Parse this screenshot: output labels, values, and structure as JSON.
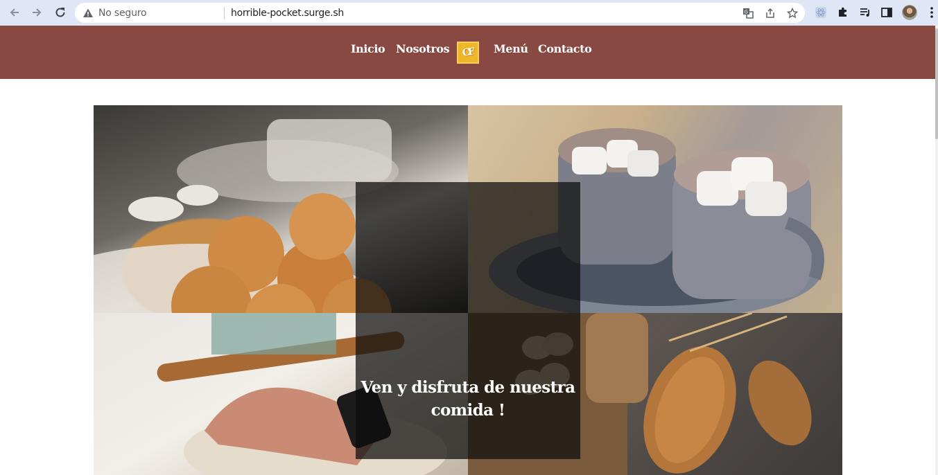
{
  "browser": {
    "security_label": "No seguro",
    "url": "horrible-pocket.surge.sh",
    "icons": [
      "back-arrow-icon",
      "forward-arrow-icon",
      "reload-icon",
      "warning-icon",
      "translate-icon",
      "share-icon",
      "star-icon",
      "extension-react-icon",
      "puzzle-icon",
      "media-queue-icon",
      "side-panel-icon",
      "kebab-menu-icon"
    ]
  },
  "site_nav": {
    "links": [
      {
        "label": "Inicio"
      },
      {
        "label": "Nosotros"
      },
      {
        "label": "Menú"
      },
      {
        "label": "Contacto"
      }
    ],
    "logo_text": "CF"
  },
  "hero": {
    "title": "Ven y disfruta de nuestra comida !",
    "images": [
      {
        "name": "pan-de-bono-and-coffee-photo"
      },
      {
        "name": "hot-chocolate-marshmallows-photo"
      },
      {
        "name": "kneading-dough-photo"
      },
      {
        "name": "bread-and-eggs-photo"
      }
    ]
  },
  "colors": {
    "nav_background": "#874942",
    "chrome_background": "#dfe6f6",
    "logo_background": "#f0b62a"
  }
}
